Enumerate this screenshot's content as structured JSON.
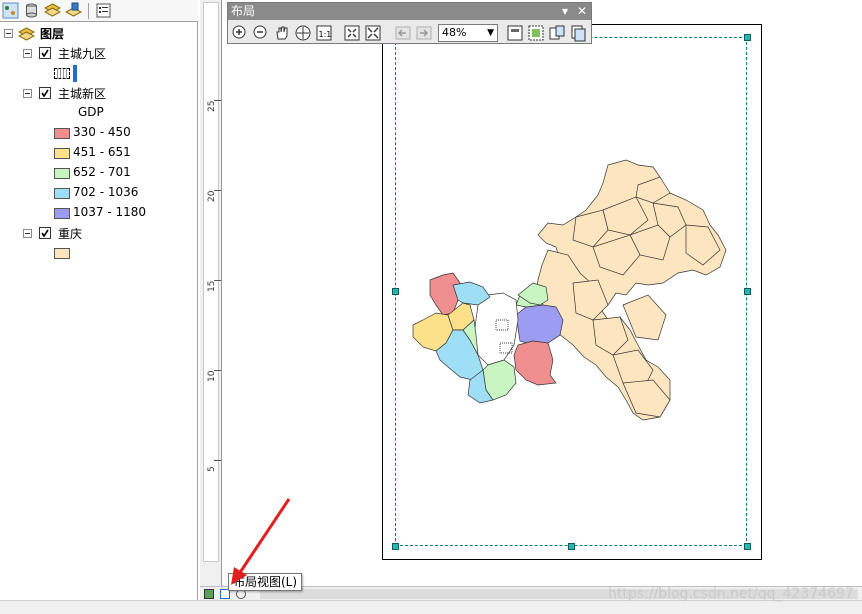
{
  "toc": {
    "toolbar_icons": [
      "list-by-drawing-order-icon",
      "list-by-source-icon",
      "list-by-visibility-icon",
      "list-by-selection-icon",
      "options-icon"
    ],
    "root_label": "图层",
    "layers": [
      {
        "name": "主城九区",
        "checked": true,
        "legend": [
          {
            "label": "",
            "color": "#ffffff",
            "pattern": "dotted"
          }
        ]
      },
      {
        "name": "主城新区",
        "checked": true,
        "field": "GDP",
        "legend": [
          {
            "label": "330 - 450",
            "color": "#f08f8f"
          },
          {
            "label": "451 - 651",
            "color": "#fde08a"
          },
          {
            "label": "652 - 701",
            "color": "#c9f5c2"
          },
          {
            "label": "702 - 1036",
            "color": "#9fdff5"
          },
          {
            "label": "1037 - 1180",
            "color": "#9c9cf2"
          }
        ]
      },
      {
        "name": "重庆",
        "checked": true,
        "legend": [
          {
            "label": "",
            "color": "#fde6bf"
          }
        ]
      }
    ]
  },
  "ruler": {
    "labels": [
      "25",
      "20",
      "15",
      "10",
      "5"
    ]
  },
  "layout_toolbar": {
    "title": "布局",
    "zoom": "48%",
    "buttons": [
      "zoom-in-icon",
      "zoom-out-icon",
      "pan-icon",
      "zoom-whole-page-icon",
      "zoom-100-icon",
      "fixed-zoom-in-icon",
      "fixed-zoom-out-icon",
      "back-extent-icon",
      "forward-extent-icon",
      "toggle-draft-mode-icon",
      "focus-data-frame-icon",
      "change-layout-icon",
      "data-driven-pages-icon"
    ]
  },
  "tooltip": "布局视图(L)",
  "watermark": "https://blog.csdn.net/qq_42374697",
  "colors": {
    "c1": "#f08f8f",
    "c2": "#fde08a",
    "c3": "#c9f5c2",
    "c4": "#9fdff5",
    "c5": "#9c9cf2",
    "base": "#fde6bf",
    "arrow": "#e02020"
  }
}
